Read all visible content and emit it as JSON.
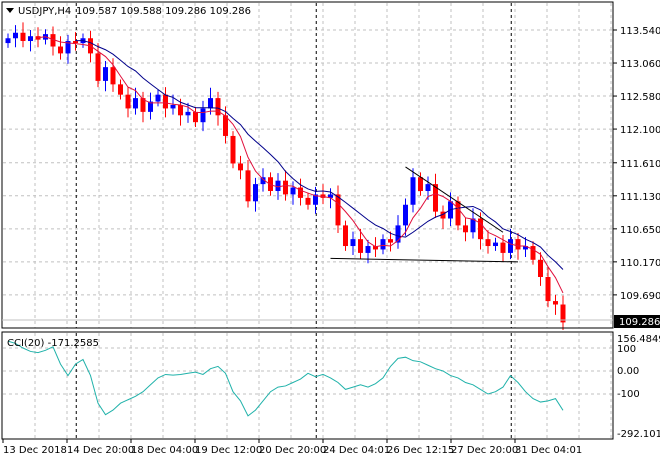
{
  "header": {
    "symbol": "USDJPY,H4",
    "ohlc": "109.587 109.588 109.286 109.286"
  },
  "colors": {
    "bull": "#0000ff",
    "bear": "#ff0000",
    "ma_fast": "#e0103c",
    "ma_slow": "#00008b",
    "cci": "#20b2aa",
    "grid": "#c0c0c0"
  },
  "chart_data": [
    {
      "type": "candlestick",
      "title": "USDJPY,H4",
      "ylim": [
        109.2,
        113.9
      ],
      "y_ticks": [
        "113.540",
        "113.060",
        "112.580",
        "112.100",
        "111.610",
        "111.130",
        "110.650",
        "110.170",
        "109.690"
      ],
      "y_tick_values": [
        113.54,
        113.06,
        112.58,
        112.1,
        111.61,
        111.13,
        110.65,
        110.17,
        109.69
      ],
      "current_price": "109.286",
      "first_open": 113.35,
      "closes": [
        113.42,
        113.5,
        113.38,
        113.45,
        113.4,
        113.48,
        113.3,
        113.2,
        113.38,
        113.35,
        113.42,
        113.2,
        112.8,
        113.0,
        112.75,
        112.6,
        112.4,
        112.55,
        112.35,
        112.5,
        112.6,
        112.4,
        112.45,
        112.3,
        112.35,
        112.2,
        112.4,
        112.55,
        112.3,
        112.0,
        111.6,
        111.5,
        111.05,
        111.3,
        111.4,
        111.2,
        111.35,
        111.15,
        111.25,
        111.1,
        111.0,
        111.15,
        111.1,
        111.15,
        110.7,
        110.4,
        110.5,
        110.3,
        110.4,
        110.35,
        110.5,
        110.45,
        110.7,
        111.0,
        111.4,
        111.2,
        111.3,
        110.9,
        110.8,
        111.05,
        110.7,
        110.6,
        110.8,
        110.5,
        110.4,
        110.45,
        110.3,
        110.5,
        110.35,
        110.4,
        110.2,
        109.95,
        109.6,
        109.55,
        109.29
      ],
      "ma_periods": {
        "fast": 5,
        "slow": 10
      },
      "trendlines": [
        {
          "name": "resistance",
          "from": [
            53,
            111.55
          ],
          "to": [
            66,
            110.6
          ]
        },
        {
          "name": "support",
          "from": [
            43,
            110.22
          ],
          "to": [
            68,
            110.17
          ]
        }
      ],
      "x_labels": [
        "13 Dec 2018",
        "14 Dec 20:00",
        "18 Dec 04:00",
        "19 Dec 12:00",
        "20 Dec 20:00",
        "24 Dec 04:01",
        "26 Dec 12:15",
        "27 Dec 20:00",
        "31 Dec 04:01"
      ],
      "period_separators": [
        9,
        41,
        67
      ]
    },
    {
      "type": "line",
      "title": "CCI(20) -171.2585",
      "ylim": [
        -292.1019,
        156.4849
      ],
      "y_ticks": [
        "156.4849",
        "100",
        "0.00",
        "-100",
        "-292.1019"
      ],
      "y_tick_values": [
        156.4849,
        100,
        0,
        -100,
        -292.1019
      ],
      "values": [
        130,
        120,
        100,
        85,
        80,
        90,
        105,
        30,
        -20,
        30,
        50,
        -20,
        -140,
        -190,
        -170,
        -140,
        -125,
        -110,
        -90,
        -60,
        -30,
        -15,
        -18,
        -15,
        -10,
        -5,
        -15,
        10,
        20,
        -10,
        -90,
        -130,
        -195,
        -170,
        -130,
        -90,
        -70,
        -65,
        -50,
        -35,
        -10,
        -25,
        -15,
        -30,
        -50,
        -80,
        -70,
        -60,
        -70,
        -55,
        -30,
        20,
        55,
        60,
        45,
        40,
        25,
        10,
        0,
        -20,
        -30,
        -50,
        -60,
        -80,
        -100,
        -90,
        -70,
        -20,
        -50,
        -90,
        -120,
        -135,
        -130,
        -120,
        -171
      ]
    }
  ]
}
